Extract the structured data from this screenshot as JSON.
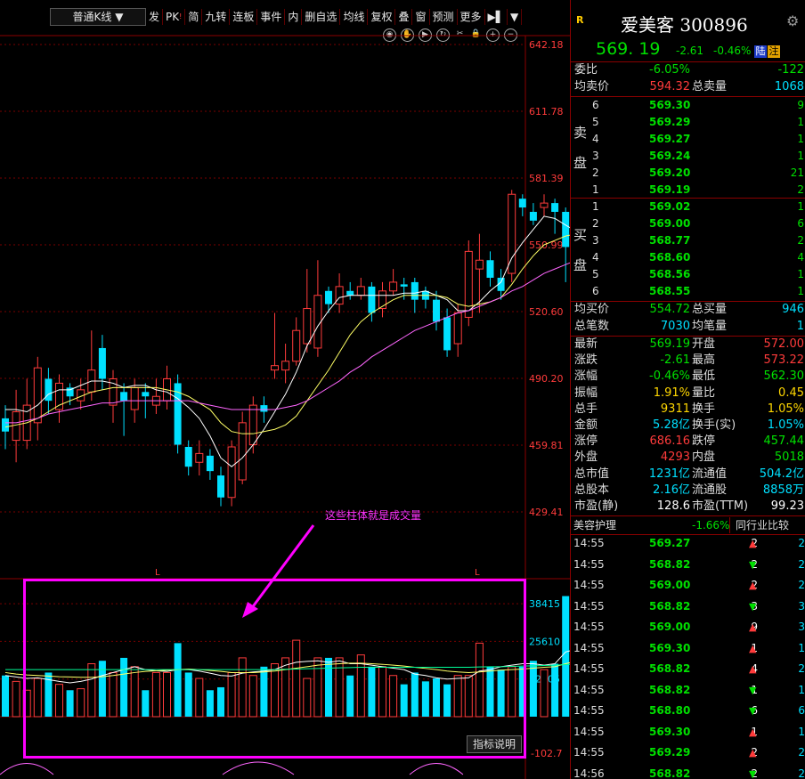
{
  "toolbar": {
    "chart_type": "普通K线",
    "items": [
      {
        "label": "发",
        "tag": ""
      },
      {
        "label": "PK",
        "tag": "!"
      },
      {
        "label": "简",
        "tag": ""
      },
      {
        "label": "九转",
        "tag": ""
      },
      {
        "label": "连板",
        "tag": ""
      },
      {
        "label": "事件",
        "tag": ""
      },
      {
        "label": "内",
        "tag": ""
      },
      {
        "label": "删自选",
        "tag": ""
      },
      {
        "label": "均线",
        "tag": ""
      },
      {
        "label": "复权",
        "tag": ""
      },
      {
        "label": "叠",
        "tag": ""
      },
      {
        "label": "窗",
        "tag": ""
      },
      {
        "label": "预测",
        "tag": ""
      },
      {
        "label": "更多",
        "tag": ""
      }
    ]
  },
  "price_axis": [
    "642.18",
    "611.78",
    "581.39",
    "550.99",
    "520.60",
    "490.20",
    "459.81",
    "429.41"
  ],
  "volume_axis": [
    "38415",
    "25610",
    "12805"
  ],
  "indicator_axis": "-102.7",
  "l_markers": [
    "L",
    "L"
  ],
  "annotation": "这些柱体就是成交量",
  "indicator_button": "指标说明",
  "colors": {
    "up": "#ff3b3b",
    "down": "#00e0ff",
    "ma5": "#ffffff",
    "ma10": "#ffff66",
    "ma20": "#ff66ff",
    "ma60": "#00ff99",
    "highlight": "#ff00ff"
  },
  "chart_data": {
    "type": "candlestick",
    "ylim": [
      429.41,
      642.18
    ],
    "candles": [
      {
        "o": 472,
        "c": 466,
        "h": 478,
        "l": 458
      },
      {
        "o": 462,
        "c": 475,
        "h": 485,
        "l": 452
      },
      {
        "o": 462,
        "c": 478,
        "h": 490,
        "l": 458
      },
      {
        "o": 470,
        "c": 495,
        "h": 500,
        "l": 462
      },
      {
        "o": 490,
        "c": 480,
        "h": 495,
        "l": 474
      },
      {
        "o": 476,
        "c": 488,
        "h": 492,
        "l": 470
      },
      {
        "o": 486,
        "c": 482,
        "h": 488,
        "l": 478
      },
      {
        "o": 480,
        "c": 485,
        "h": 490,
        "l": 476
      },
      {
        "o": 484,
        "c": 494,
        "h": 512,
        "l": 480
      },
      {
        "o": 504,
        "c": 490,
        "h": 510,
        "l": 485
      },
      {
        "o": 478,
        "c": 490,
        "h": 494,
        "l": 470
      },
      {
        "o": 484,
        "c": 480,
        "h": 488,
        "l": 464
      },
      {
        "o": 476,
        "c": 486,
        "h": 490,
        "l": 470
      },
      {
        "o": 484,
        "c": 482,
        "h": 488,
        "l": 472
      },
      {
        "o": 478,
        "c": 482,
        "h": 490,
        "l": 474
      },
      {
        "o": 480,
        "c": 490,
        "h": 496,
        "l": 476
      },
      {
        "o": 488,
        "c": 460,
        "h": 492,
        "l": 456
      },
      {
        "o": 459,
        "c": 450,
        "h": 462,
        "l": 446
      },
      {
        "o": 452,
        "c": 456,
        "h": 462,
        "l": 446
      },
      {
        "o": 455,
        "c": 448,
        "h": 458,
        "l": 444
      },
      {
        "o": 446,
        "c": 436,
        "h": 450,
        "l": 432
      },
      {
        "o": 436,
        "c": 459,
        "h": 462,
        "l": 432
      },
      {
        "o": 444,
        "c": 470,
        "h": 475,
        "l": 442
      },
      {
        "o": 460,
        "c": 478,
        "h": 482,
        "l": 456
      },
      {
        "o": 478,
        "c": 475,
        "h": 482,
        "l": 470
      },
      {
        "o": 494,
        "c": 496,
        "h": 520,
        "l": 490
      },
      {
        "o": 494,
        "c": 498,
        "h": 506,
        "l": 488
      },
      {
        "o": 498,
        "c": 512,
        "h": 518,
        "l": 496
      },
      {
        "o": 506,
        "c": 522,
        "h": 540,
        "l": 502
      },
      {
        "o": 504,
        "c": 528,
        "h": 544,
        "l": 500
      },
      {
        "o": 530,
        "c": 524,
        "h": 532,
        "l": 520
      },
      {
        "o": 524,
        "c": 532,
        "h": 538,
        "l": 520
      },
      {
        "o": 530,
        "c": 528,
        "h": 534,
        "l": 526
      },
      {
        "o": 528,
        "c": 532,
        "h": 536,
        "l": 526
      },
      {
        "o": 532,
        "c": 520,
        "h": 534,
        "l": 516
      },
      {
        "o": 522,
        "c": 530,
        "h": 534,
        "l": 518
      },
      {
        "o": 530,
        "c": 534,
        "h": 540,
        "l": 528
      },
      {
        "o": 533,
        "c": 532,
        "h": 536,
        "l": 526
      },
      {
        "o": 534,
        "c": 526,
        "h": 536,
        "l": 520
      },
      {
        "o": 530,
        "c": 526,
        "h": 532,
        "l": 522
      },
      {
        "o": 526,
        "c": 516,
        "h": 530,
        "l": 512
      },
      {
        "o": 518,
        "c": 503,
        "h": 522,
        "l": 500
      },
      {
        "o": 506,
        "c": 520,
        "h": 524,
        "l": 500
      },
      {
        "o": 518,
        "c": 548,
        "h": 553,
        "l": 514
      },
      {
        "o": 540,
        "c": 544,
        "h": 556,
        "l": 520
      },
      {
        "o": 544,
        "c": 536,
        "h": 548,
        "l": 532
      },
      {
        "o": 536,
        "c": 530,
        "h": 540,
        "l": 526
      },
      {
        "o": 538,
        "c": 574,
        "h": 576,
        "l": 534
      },
      {
        "o": 572,
        "c": 568,
        "h": 574,
        "l": 564
      },
      {
        "o": 566,
        "c": 562,
        "h": 570,
        "l": 560
      },
      {
        "o": 568,
        "c": 570,
        "h": 574,
        "l": 564
      },
      {
        "o": 570,
        "c": 566,
        "h": 572,
        "l": 556
      },
      {
        "o": 566,
        "c": 550,
        "h": 568,
        "l": 534
      },
      {
        "o": 554,
        "c": 538,
        "h": 558,
        "l": 536
      },
      {
        "o": 542,
        "c": 572,
        "h": 584,
        "l": 540
      },
      {
        "o": 572,
        "c": 569.19,
        "h": 573.22,
        "l": 562.3
      }
    ],
    "ma5": [
      476,
      476,
      475,
      478,
      483,
      485,
      485,
      487,
      489,
      489,
      488,
      486,
      487,
      487,
      485,
      484,
      481,
      477,
      472,
      464,
      454,
      450,
      454,
      460,
      467,
      475,
      483,
      493,
      505,
      514,
      521,
      527,
      528,
      528,
      528,
      528,
      528,
      529,
      529,
      530,
      528,
      526,
      521,
      521,
      525,
      530,
      534,
      545,
      552,
      558,
      564,
      563,
      560,
      557,
      555,
      557
    ],
    "ma10": [
      468,
      469,
      470,
      472,
      475,
      478,
      480,
      482,
      484,
      485,
      486,
      486,
      486,
      486,
      486,
      485,
      484,
      482,
      479,
      476,
      470,
      466,
      465,
      465,
      466,
      467,
      469,
      473,
      480,
      487,
      494,
      502,
      510,
      516,
      520,
      523,
      526,
      528,
      528,
      528,
      528,
      527,
      524,
      523,
      524,
      525,
      527,
      533,
      540,
      546,
      551,
      553,
      555,
      556,
      557,
      559
    ],
    "ma20": [
      470,
      470,
      471,
      472,
      474,
      475,
      476,
      477,
      478,
      479,
      479,
      480,
      480,
      480,
      480,
      480,
      480,
      480,
      479,
      478,
      477,
      476,
      476,
      476,
      476,
      476,
      477,
      478,
      480,
      483,
      486,
      489,
      493,
      496,
      500,
      503,
      506,
      509,
      512,
      514,
      516,
      518,
      520,
      521,
      523,
      525,
      527,
      530,
      532,
      535,
      538,
      540,
      542,
      544,
      546,
      549
    ],
    "volumes": [
      14000,
      12000,
      9000,
      13000,
      15000,
      11000,
      9000,
      9500,
      18000,
      19000,
      15000,
      20000,
      17000,
      9000,
      15000,
      15000,
      25000,
      15000,
      13000,
      9000,
      10000,
      15000,
      20000,
      14000,
      17000,
      18000,
      20000,
      26000,
      13000,
      20000,
      20000,
      20000,
      14000,
      21000,
      17000,
      17000,
      14000,
      11000,
      15000,
      12000,
      13000,
      11000,
      14000,
      14000,
      25000,
      17000,
      16000,
      17000,
      17000,
      19000,
      16000,
      18000,
      41000,
      24000,
      19000,
      12000
    ],
    "vol_ma5": [
      14000,
      13500,
      13000,
      13200,
      12600,
      12000,
      11500,
      12000,
      12800,
      14000,
      15000,
      16000,
      17000,
      16000,
      15600,
      15400,
      16000,
      16000,
      15500,
      14800,
      14000,
      13800,
      14800,
      15200,
      15500,
      16000,
      17500,
      18500,
      18800,
      19000,
      18500,
      19000,
      18000,
      18000,
      17500,
      17000,
      16500,
      16000,
      14500,
      14000,
      13200,
      12800,
      13000,
      13200,
      15500,
      16000,
      17000,
      17500,
      18000,
      18000,
      17500,
      18000,
      22000,
      23000,
      22000,
      21000
    ],
    "vol_ma10": [
      15000,
      14500,
      14200,
      14000,
      13800,
      13600,
      13500,
      13400,
      13400,
      13600,
      14000,
      14500,
      15000,
      15400,
      15600,
      15800,
      16000,
      16200,
      16000,
      15700,
      15400,
      15000,
      15000,
      15000,
      15200,
      15500,
      16000,
      16500,
      17000,
      17500,
      17800,
      18000,
      18200,
      18200,
      18000,
      17800,
      17500,
      17200,
      16800,
      16400,
      16000,
      15500,
      15200,
      15000,
      15200,
      15500,
      15800,
      16000,
      16200,
      16500,
      16800,
      17000,
      18000,
      19000,
      19500,
      19800
    ],
    "vol_ma60": [
      16000,
      16000,
      16000,
      16000,
      16000,
      16000,
      16000,
      16000,
      16000,
      16000,
      16000,
      16000,
      16000,
      16000,
      16000,
      16000,
      16000,
      16000,
      16000,
      16000,
      16000,
      16000,
      16000,
      16000,
      16000,
      16000,
      16100,
      16200,
      16300,
      16400,
      16500,
      16600,
      16700,
      16800,
      16800,
      16800,
      16800,
      16800,
      16800,
      16800,
      16800,
      16800,
      16800,
      16800,
      16900,
      17000,
      17000,
      17100,
      17200,
      17300,
      17400,
      17500,
      17700,
      17900,
      18000,
      18100
    ]
  },
  "quote": {
    "r_badge": "R",
    "title": "爱美客 300896",
    "price": "569. 19",
    "change": "-2.61",
    "pct": "-0.46%",
    "lu": "陆",
    "zhu": "注",
    "weibi_label": "委比",
    "weibi": "-6.05%",
    "weicha": "-122",
    "ask_avg_label": "均卖价",
    "ask_avg": "594.32",
    "ask_total_label": "总卖量",
    "ask_total": "1068",
    "ask_side": [
      "卖",
      "盘"
    ],
    "bid_side": [
      "买",
      "盘"
    ],
    "asks": [
      {
        "i": "6",
        "p": "569.30",
        "q": "9"
      },
      {
        "i": "5",
        "p": "569.29",
        "q": "1"
      },
      {
        "i": "4",
        "p": "569.27",
        "q": "1"
      },
      {
        "i": "3",
        "p": "569.24",
        "q": "1"
      },
      {
        "i": "2",
        "p": "569.20",
        "q": "21"
      },
      {
        "i": "1",
        "p": "569.19",
        "q": "2"
      }
    ],
    "bids": [
      {
        "i": "1",
        "p": "569.02",
        "q": "1"
      },
      {
        "i": "2",
        "p": "569.00",
        "q": "6"
      },
      {
        "i": "3",
        "p": "568.77",
        "q": "2"
      },
      {
        "i": "4",
        "p": "568.60",
        "q": "4"
      },
      {
        "i": "5",
        "p": "568.56",
        "q": "1"
      },
      {
        "i": "6",
        "p": "568.55",
        "q": "1"
      }
    ],
    "bid_avg_label": "均买价",
    "bid_avg": "554.72",
    "bid_total_label": "总买量",
    "bid_total": "946",
    "deals_label": "总笔数",
    "deals": "7030",
    "per_deal_label": "均笔量",
    "per_deal": "1",
    "stats": [
      {
        "l1": "最新",
        "v1": "569.19",
        "c1": "g",
        "l2": "开盘",
        "v2": "572.00",
        "c2": "r"
      },
      {
        "l1": "涨跌",
        "v1": "-2.61",
        "c1": "g",
        "l2": "最高",
        "v2": "573.22",
        "c2": "r"
      },
      {
        "l1": "涨幅",
        "v1": "-0.46%",
        "c1": "g",
        "l2": "最低",
        "v2": "562.30",
        "c2": "g"
      },
      {
        "l1": "振幅",
        "v1": "1.91%",
        "c1": "y",
        "l2": "量比",
        "v2": "0.45",
        "c2": "y"
      },
      {
        "l1": "总手",
        "v1": "9311",
        "c1": "y",
        "l2": "换手",
        "v2": "1.05%",
        "c2": "y"
      },
      {
        "l1": "金额",
        "v1": "5.28亿",
        "c1": "c",
        "l2": "换手(实)",
        "v2": "1.05%",
        "c2": "c"
      },
      {
        "l1": "涨停",
        "v1": "686.16",
        "c1": "r",
        "l2": "跌停",
        "v2": "457.44",
        "c2": "g"
      },
      {
        "l1": "外盘",
        "v1": "4293",
        "c1": "r",
        "l2": "内盘",
        "v2": "5018",
        "c2": "g"
      },
      {
        "l1": "总市值",
        "v1": "1231亿",
        "c1": "c",
        "l2": "流通值",
        "v2": "504.2亿",
        "c2": "c"
      },
      {
        "l1": "总股本",
        "v1": "2.16亿",
        "c1": "c",
        "l2": "流通股",
        "v2": "8858万",
        "c2": "c"
      },
      {
        "l1": "市盈(静)",
        "v1": "128.6",
        "c1": "w",
        "l2": "市盈(TTM)",
        "v2": "99.23",
        "c2": "w"
      }
    ],
    "industry": "美容护理",
    "industry_pct": "-1.66%",
    "industry_btn": "同行业比较",
    "ticks": [
      {
        "t": "14:55",
        "p": "569.27",
        "v": "2",
        "d": "up",
        "n": "2"
      },
      {
        "t": "14:55",
        "p": "568.82",
        "v": "2",
        "d": "down",
        "n": "2"
      },
      {
        "t": "14:55",
        "p": "569.00",
        "v": "2",
        "d": "up",
        "n": "2"
      },
      {
        "t": "14:55",
        "p": "568.82",
        "v": "3",
        "d": "down",
        "n": "3"
      },
      {
        "t": "14:55",
        "p": "569.00",
        "v": "9",
        "d": "up",
        "n": "3"
      },
      {
        "t": "14:55",
        "p": "569.30",
        "v": "1",
        "d": "up",
        "n": "1"
      },
      {
        "t": "14:55",
        "p": "568.82",
        "v": "4",
        "d": "up",
        "n": "2"
      },
      {
        "t": "14:55",
        "p": "568.82",
        "v": "1",
        "d": "down",
        "n": "1"
      },
      {
        "t": "14:55",
        "p": "568.80",
        "v": "6",
        "d": "down",
        "n": "6"
      },
      {
        "t": "14:55",
        "p": "569.30",
        "v": "1",
        "d": "up",
        "n": "1"
      },
      {
        "t": "14:55",
        "p": "569.29",
        "v": "2",
        "d": "up",
        "n": "2"
      },
      {
        "t": "14:56",
        "p": "568.82",
        "v": "2",
        "d": "down",
        "n": "2"
      }
    ]
  }
}
